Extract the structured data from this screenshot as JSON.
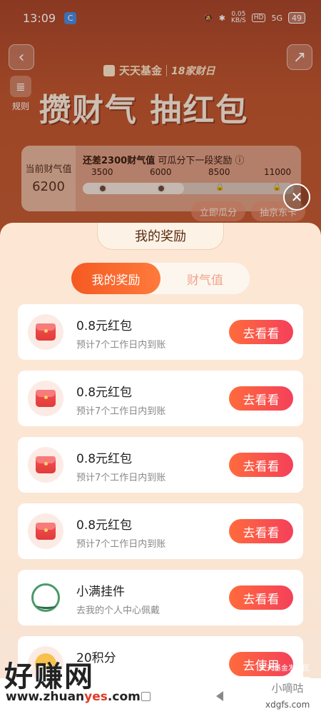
{
  "status_bar": {
    "time": "13:09",
    "app_icon": "C",
    "net_speed": "0.05",
    "net_unit": "KB/S",
    "hd": "HD",
    "signal": "5G",
    "battery": "49"
  },
  "header": {
    "brand": "天天基金",
    "event": "18家财日",
    "rules_label": "规则",
    "hero_title": "攒财气 抽红包"
  },
  "fortune": {
    "current_label": "当前财气值",
    "current_value": "6200",
    "remaining_prefix": "还差",
    "remaining_value": "2300财气值",
    "remaining_suffix": "可瓜分下一段奖励 ⓘ",
    "milestones": [
      "3500",
      "6000",
      "8500",
      "11000"
    ],
    "progress_fraction": 0.48,
    "claim_button": "立即瓜分",
    "jd_button": "抽京东卡"
  },
  "sheet": {
    "title": "我的奖励",
    "tabs": [
      {
        "label": "我的奖励",
        "active": true
      },
      {
        "label": "财气值",
        "active": false
      }
    ],
    "rewards": [
      {
        "icon": "red-packet-icon",
        "title": "0.8元红包",
        "subtitle": "预计7个工作日内到账",
        "button": "去看看"
      },
      {
        "icon": "red-packet-icon",
        "title": "0.8元红包",
        "subtitle": "预计7个工作日内到账",
        "button": "去看看"
      },
      {
        "icon": "red-packet-icon",
        "title": "0.8元红包",
        "subtitle": "预计7个工作日内到账",
        "button": "去看看"
      },
      {
        "icon": "red-packet-icon",
        "title": "0.8元红包",
        "subtitle": "预计7个工作日内到账",
        "button": "去看看"
      },
      {
        "icon": "pendant-icon",
        "title": "小满挂件",
        "subtitle": "去我的个人中心佩戴",
        "button": "去看看"
      },
      {
        "icon": "points-icon",
        "title": "20积分",
        "subtitle": "",
        "button": "去使用"
      }
    ]
  },
  "watermarks": {
    "left_text": "好赚网",
    "left_url_prefix": "www.zhuan",
    "left_url_highlight": "yes",
    "left_url_suffix": ".com",
    "right_text": "小嘀咕",
    "right_url": "xdgfs.com",
    "tiny_text": "天天基金发评区"
  },
  "colors": {
    "accent": "#f45a22",
    "button_gradient_start": "#ff6b3d",
    "button_gradient_end": "#f4405a"
  }
}
